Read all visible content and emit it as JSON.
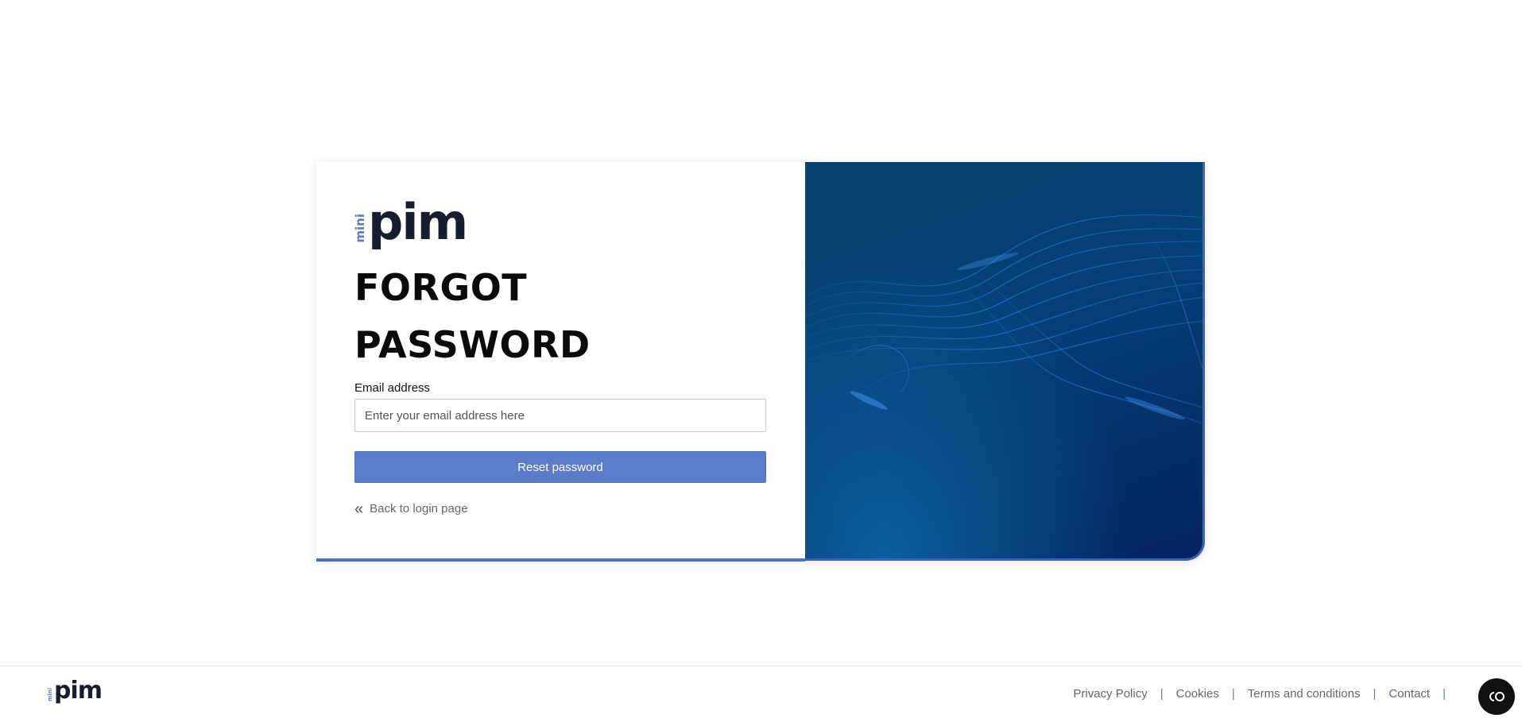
{
  "logo": {
    "prefix": "mini",
    "name": "pim"
  },
  "form": {
    "title_line1": "FORGOT",
    "title_line2": "PASSWORD",
    "email_label": "Email address",
    "email_placeholder": "Enter your email address here",
    "email_value": "",
    "submit_label": "Reset password",
    "back_link": "Back to login page",
    "back_icon": "double-chevron-left-icon"
  },
  "footer": {
    "logo": {
      "prefix": "mini",
      "name": "pim"
    },
    "links": {
      "privacy": "Privacy Policy",
      "cookies": "Cookies",
      "terms": "Terms and conditions",
      "contact": "Contact"
    },
    "separator": "|",
    "cookie_button_icon": "cookie-consent-icon"
  },
  "colors": {
    "accent": "#5b7cc9",
    "logo_dark": "#151d2e",
    "panel_dark": "#04245e",
    "panel_mid": "#06426e"
  }
}
